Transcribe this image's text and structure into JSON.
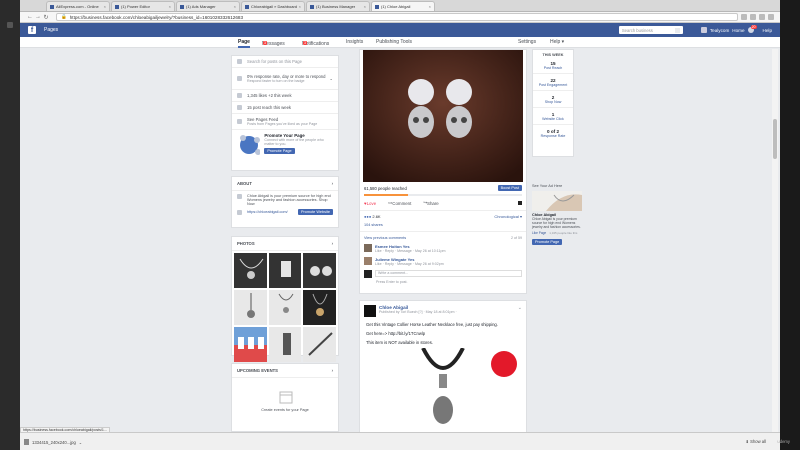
{
  "browser": {
    "tabs": [
      {
        "label": "AliExpress.com - Online"
      },
      {
        "label": "(1) Power Editor"
      },
      {
        "label": "(1) Ads Manager"
      },
      {
        "label": "Chloeabigail » Dashboard"
      },
      {
        "label": "(1) Business Manager"
      },
      {
        "label": "(1) Chloe Abigail"
      }
    ],
    "url": "https://business.facebook.com/chloeabigailjewelry/?business_id=1601028332612683"
  },
  "facebook": {
    "logo": "f",
    "pages_label": "Pages",
    "search_placeholder": "Search business",
    "user_label": "Tealycom",
    "home_label": "Home",
    "notif_count": "20",
    "help_label": "Help"
  },
  "page_tabs": [
    {
      "label": "Page",
      "active": true
    },
    {
      "label": "Messages",
      "badge": "3"
    },
    {
      "label": "Notifications",
      "badge": "3"
    },
    {
      "label": "Insights"
    },
    {
      "label": "Publishing Tools"
    }
  ],
  "page_tabs_right": {
    "settings": "Settings",
    "help": "Help ▾"
  },
  "left": {
    "search_placeholder": "Search for posts on this Page",
    "rows": [
      {
        "text": "0% response rate, day or more to respond",
        "sub": "Respond faster to turn on the badge"
      },
      {
        "text": "1,345 likes +2 this week"
      },
      {
        "text": "15 post reach this week"
      },
      {
        "text": "See Pages Feed",
        "sub": "Posts from Pages you've liked as your Page"
      }
    ],
    "promote": {
      "title": "Promote Your Page",
      "desc": "Connect with more of the people who matter to you.",
      "button": "Promote Page"
    },
    "about": {
      "heading": "ABOUT",
      "text": "Chloe Abigail is your premium source for high end Womens jewelry and fashion accessories. Shop Now",
      "link": "https://chloeabigail.com/",
      "button": "Promote Website"
    },
    "photos_heading": "PHOTOS",
    "events": {
      "heading": "UPCOMING EVENTS",
      "text": "Create events for your Page"
    }
  },
  "feed": {
    "reach": "61,580 people reached",
    "boost": "Boost Post",
    "actions": [
      "Love",
      "Comment",
      "Share"
    ],
    "reactions": "2.6K",
    "order": "Chronological ▾",
    "shares": "104 shares",
    "view_prev": "View previous comments",
    "count": "2 of 59",
    "comments": [
      {
        "name": "Esmee Hoiton Yes",
        "meta": "Like · Reply · Message · May 26 at 10:11pm"
      },
      {
        "name": "Julieme Wingate Yes",
        "meta": "Like · Reply · Message · May 26 at 9:02pm"
      }
    ],
    "write_comment": "Write a comment...",
    "press_enter": "Press Enter to post.",
    "post2": {
      "name": "Chloe Abigail",
      "meta": "Published by Tori Buech [?] · May 18 at 8:01pm ·",
      "text1": "Get this Vintage Collier Horse Leather Necklace free, just pay shipping.",
      "text2": "Get here=> http://bit.ly/1TCnwlp",
      "text3": "This item is NOT available in stores.",
      "badge": "GET IT FREE"
    }
  },
  "week": {
    "heading": "THIS WEEK",
    "stats": [
      {
        "num": "15",
        "label": "Post Reach"
      },
      {
        "num": "22",
        "label": "Post Engagement"
      },
      {
        "num": "2",
        "label": "Shop Now"
      },
      {
        "num": "1",
        "label": "Website Click"
      },
      {
        "num": "0 of 2",
        "label": "Response Rate"
      }
    ]
  },
  "ad": {
    "heading": "See Your Ad Here",
    "name": "Chloe Abigail",
    "text": "Chloe Abigail is your premium source for high end Womens jewelry and fashion accessories.",
    "like": "Like Page",
    "likes": "1,345 people like this",
    "button": "Promote Page"
  },
  "status": {
    "hover": "https://business.facebook.com/chloeabigail/posts/1...",
    "download": "1334415_240x240...jpg",
    "show_all": "Show all",
    "watermark": "udemy"
  }
}
